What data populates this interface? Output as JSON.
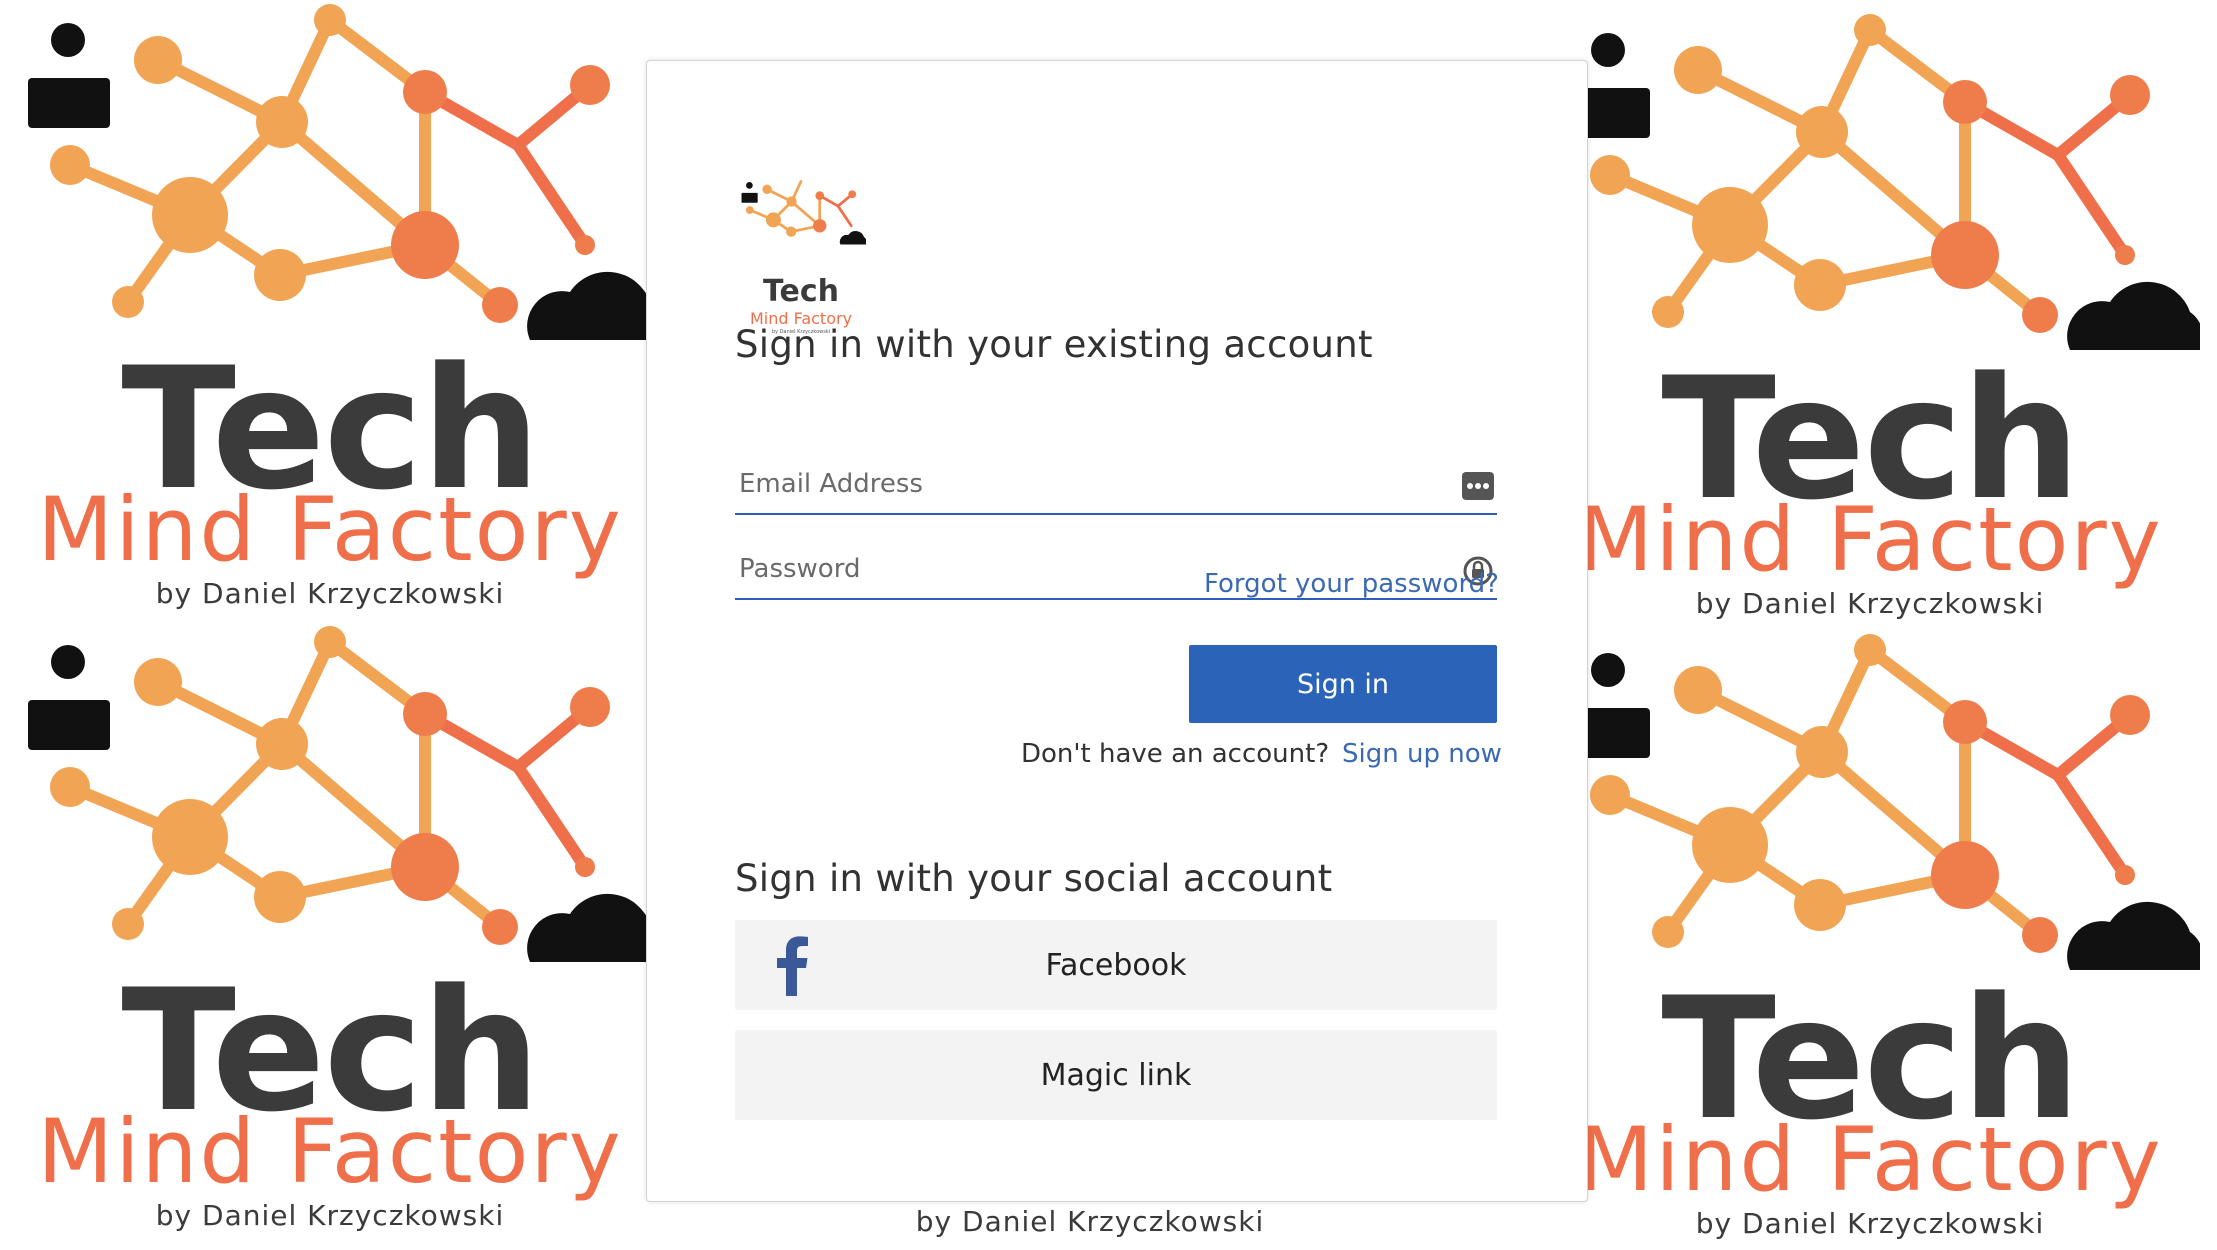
{
  "background": {
    "tech": "Tech",
    "mind_factory": "Mind Factory",
    "byline": "by Daniel Krzyczkowski"
  },
  "brand": {
    "tech": "Tech",
    "mind_factory": "Mind Factory",
    "byline": "by Daniel Krzyczkowski"
  },
  "signin": {
    "heading": "Sign in with your existing account",
    "email_placeholder": "Email Address",
    "password_placeholder": "Password",
    "forgot_password": "Forgot your password?",
    "sign_in_button": "Sign in",
    "no_account_text": "Don't have an account?",
    "sign_up_link": "Sign up now"
  },
  "social": {
    "heading": "Sign in with your social account",
    "facebook": "Facebook",
    "magic_link": "Magic link"
  },
  "colors": {
    "accent": "#2a63b7",
    "link": "#3c6ab2",
    "brand_orange": "#ef6f4a",
    "brand_dark": "#3b3b3b"
  }
}
